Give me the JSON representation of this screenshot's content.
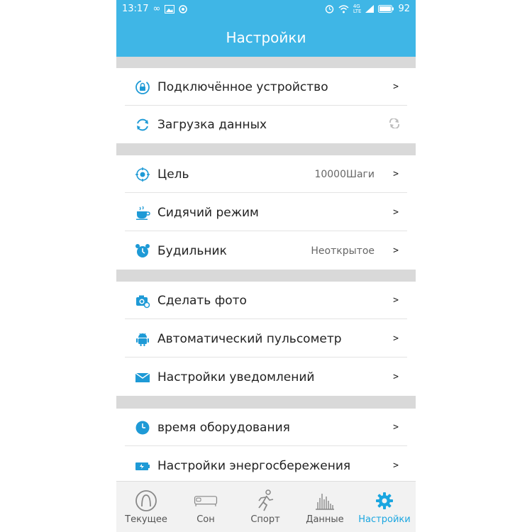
{
  "status_bar": {
    "time": "13:17",
    "network": "4G",
    "lte": "LTE",
    "battery": "92"
  },
  "header": {
    "title": "Настройки"
  },
  "settings": {
    "connected_device": {
      "label": "Подключённое устройство",
      "chevron": ">"
    },
    "data_upload": {
      "label": "Загрузка данных"
    },
    "goal": {
      "label": "Цель",
      "value": "10000Шаги",
      "chevron": ">"
    },
    "sedentary": {
      "label": "Сидячий режим",
      "chevron": ">"
    },
    "alarm": {
      "label": "Будильник",
      "value": "Неоткрытое",
      "chevron": ">"
    },
    "take_photo": {
      "label": "Сделать фото",
      "chevron": ">"
    },
    "auto_hr": {
      "label": "Автоматический пульсометр",
      "chevron": ">"
    },
    "notifications": {
      "label": "Настройки уведомлений",
      "chevron": ">"
    },
    "device_time": {
      "label": "время оборудования",
      "chevron": ">"
    },
    "power_saving": {
      "label": "Настройки энергосбережения",
      "chevron": ">"
    }
  },
  "tabbar": {
    "tabs": [
      {
        "label": "Текущее",
        "icon": "current-icon"
      },
      {
        "label": "Сон",
        "icon": "bed-icon"
      },
      {
        "label": "Спорт",
        "icon": "runner-icon"
      },
      {
        "label": "Данные",
        "icon": "chart-icon"
      },
      {
        "label": "Настройки",
        "icon": "gear-icon"
      }
    ],
    "active": "Настройки"
  },
  "colors": {
    "accent": "#3fb6e6",
    "active_tab": "#1aa6e0",
    "icon_blue": "#1e9ad6",
    "section_gap": "#d9d9d9"
  }
}
